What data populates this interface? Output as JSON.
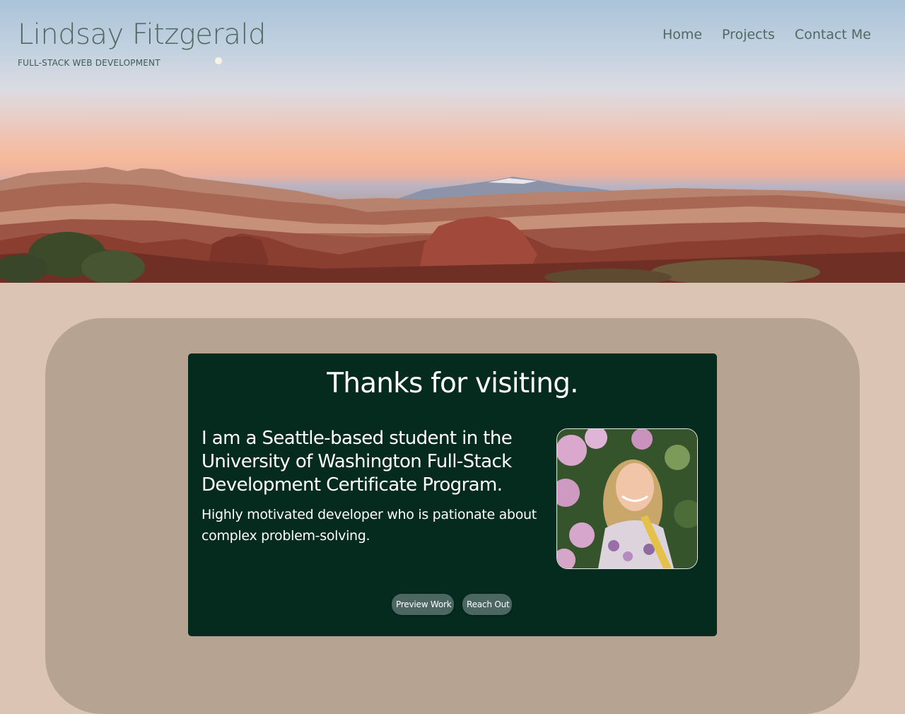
{
  "header": {
    "title": "Lindsay Fitzgerald",
    "tagline": "FULL-STACK WEB DEVELOPMENT",
    "hero_image": "canyon-sunset-landscape"
  },
  "nav": {
    "items": [
      "Home",
      "Projects",
      "Contact Me"
    ]
  },
  "about": {
    "heading": "Thanks for visiting.",
    "intro": "I am a Seattle-based student in the University of Washington Full-Stack Development Certificate Program.",
    "summary": "Highly motivated developer who is pationate about complex problem-solving.",
    "portrait_image": "portrait-photo"
  },
  "buttons": {
    "preview": "Preview Work",
    "reach": "Reach Out"
  },
  "colors": {
    "page_background": "#dbc4b4",
    "panel": "#b6a391",
    "card": "#052a1e",
    "button": "#4c6661",
    "header_text": "#4e6a63"
  }
}
